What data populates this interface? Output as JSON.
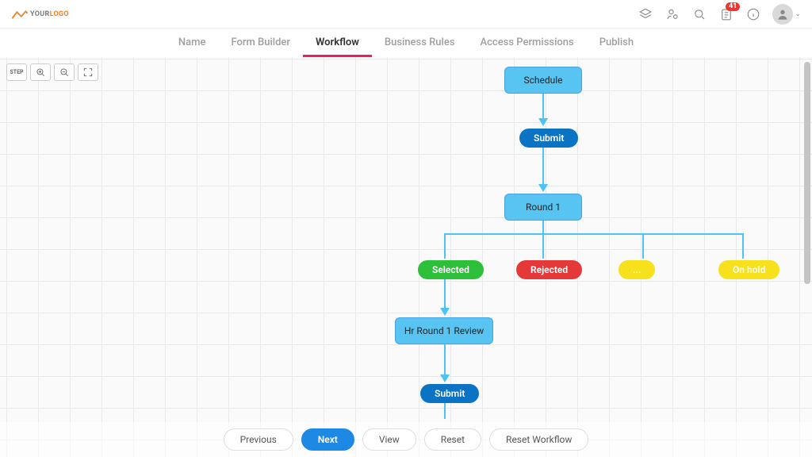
{
  "logo": {
    "first": "YOUR",
    "second": "LOGO"
  },
  "notification_count": "41",
  "tabs": [
    {
      "label": "Name",
      "active": false
    },
    {
      "label": "Form Builder",
      "active": false
    },
    {
      "label": "Workflow",
      "active": true
    },
    {
      "label": "Business Rules",
      "active": false
    },
    {
      "label": "Access Permissions",
      "active": false
    },
    {
      "label": "Publish",
      "active": false
    }
  ],
  "nodes": {
    "schedule": "Schedule",
    "submit1": "Submit",
    "round1": "Round 1",
    "selected": "Selected",
    "rejected": "Rejected",
    "onhold": "On hold",
    "hr_review": "Hr Round 1 Review",
    "submit2": "Submit"
  },
  "footer": {
    "previous": "Previous",
    "next": "Next",
    "view": "View",
    "reset": "Reset",
    "reset_workflow": "Reset Workflow"
  }
}
